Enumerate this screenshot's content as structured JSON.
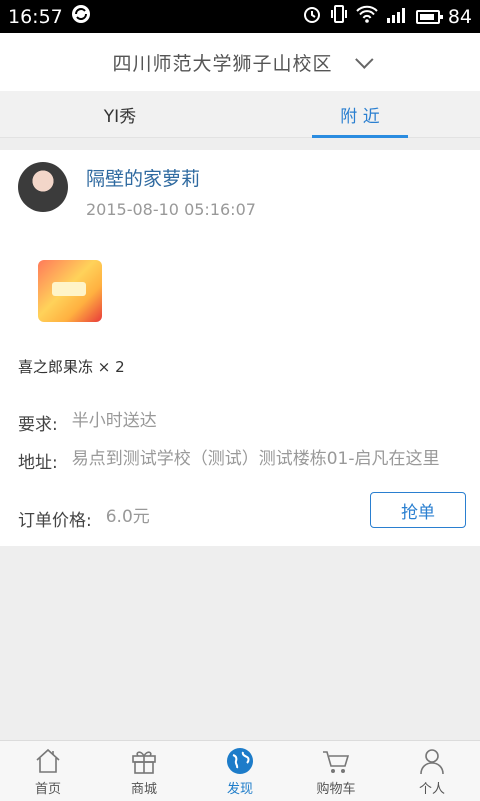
{
  "status_bar": {
    "time": "16:57",
    "battery": "84"
  },
  "header": {
    "campus": "四川师范大学狮子山校区"
  },
  "tabs": [
    {
      "label": "YI秀",
      "active": false
    },
    {
      "label": "附 近",
      "active": true
    }
  ],
  "order": {
    "user_name": "隔壁的家萝莉",
    "time": "2015-08-10 05:16:07",
    "product": "喜之郎果冻 × 2",
    "requirement_label": "要求:",
    "requirement": "半小时送达",
    "address_label": "地址:",
    "address": "易点到测试学校（测试）测试楼栋01-启凡在这里",
    "price_label": "订单价格:",
    "price": "6.0元",
    "grab_button": "抢单"
  },
  "bottom_nav": [
    {
      "label": "首页",
      "icon": "home-icon",
      "active": false
    },
    {
      "label": "商城",
      "icon": "gift-icon",
      "active": false
    },
    {
      "label": "发现",
      "icon": "globe-icon",
      "active": true
    },
    {
      "label": "购物车",
      "icon": "cart-icon",
      "active": false
    },
    {
      "label": "个人",
      "icon": "person-icon",
      "active": false
    }
  ],
  "colors": {
    "accent": "#2a7fd0",
    "username": "#2f6aa0"
  }
}
